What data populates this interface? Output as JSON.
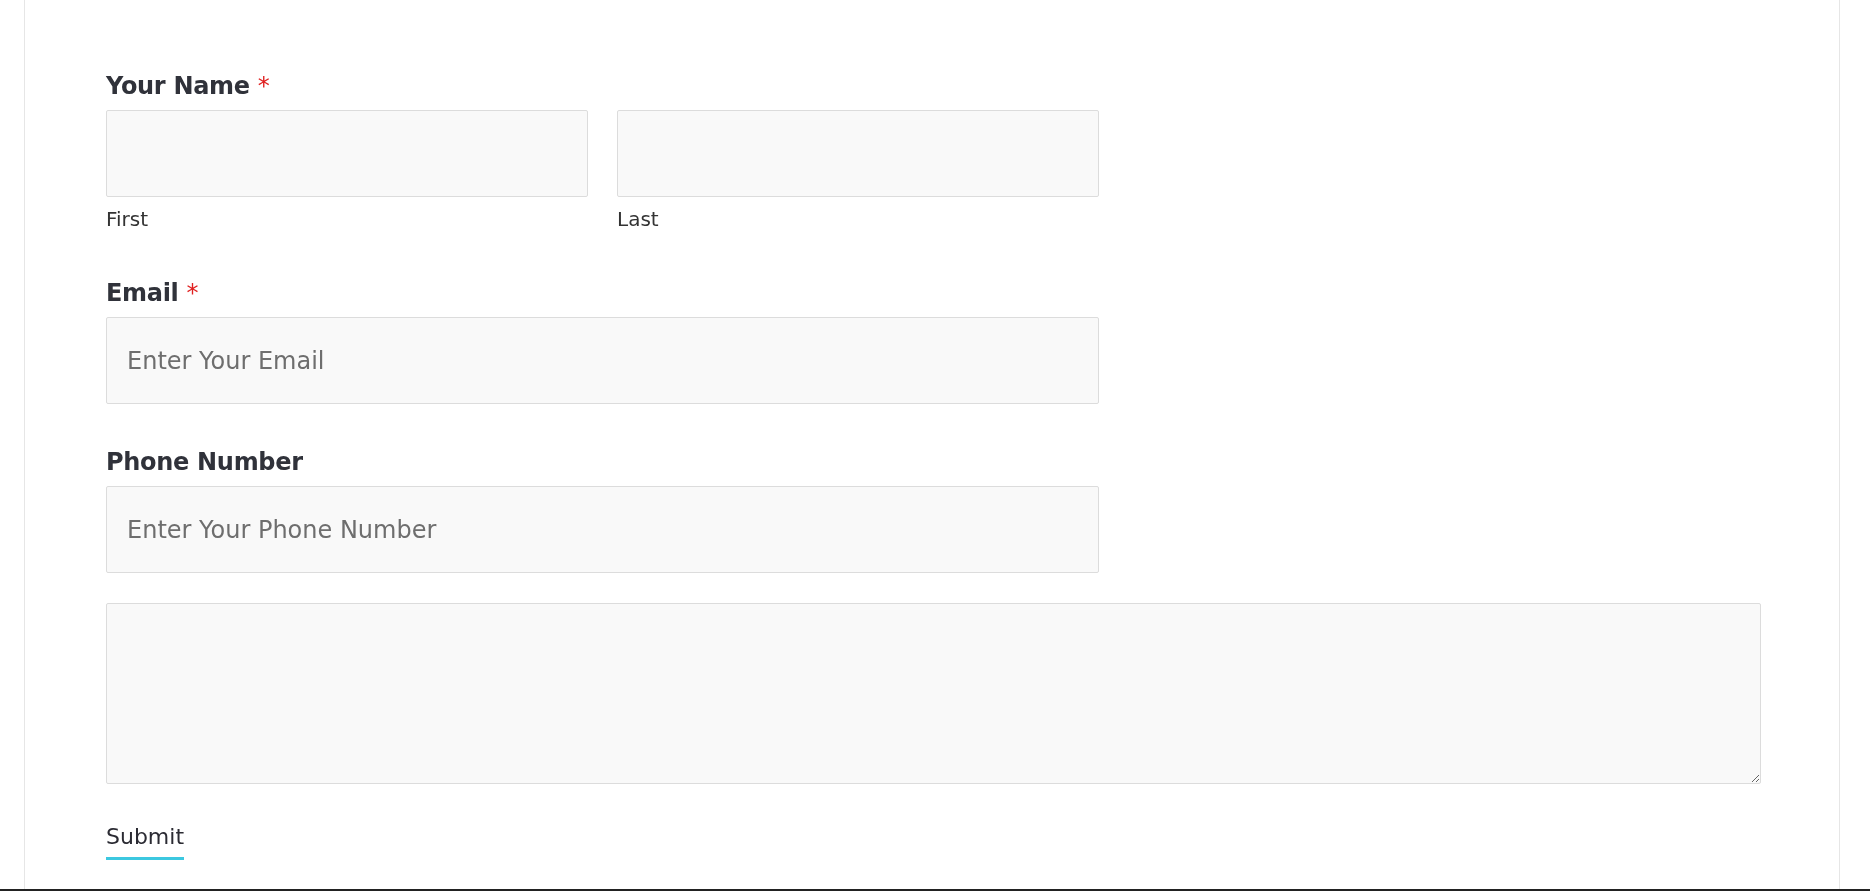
{
  "form": {
    "name_field": {
      "label": "Your Name",
      "required_mark": "*",
      "parts": [
        {
          "sublabel": "First"
        },
        {
          "sublabel": "Last"
        }
      ]
    },
    "fields": [
      {
        "label": "Email",
        "required_mark": "*",
        "placeholder": "Enter Your Email"
      },
      {
        "label": "Phone Number",
        "placeholder": "Enter Your Phone Number"
      }
    ],
    "message": {
      "kind": "textarea"
    },
    "submit": "Submit"
  }
}
